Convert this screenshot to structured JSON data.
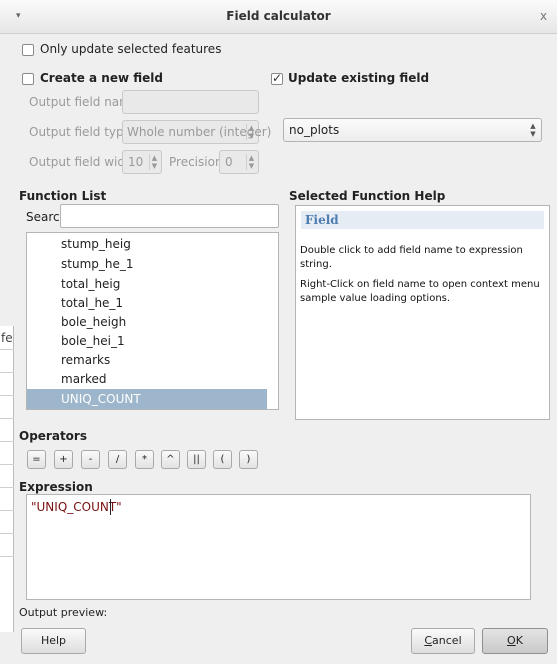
{
  "window": {
    "title": "Field calculator",
    "menu_glyph": "▾",
    "close_glyph": "x"
  },
  "options": {
    "only_selected": {
      "label": "Only update selected features",
      "checked": false
    },
    "create_new": {
      "label": "Create a new field",
      "checked": false
    },
    "update_existing": {
      "label": "Update existing field",
      "checked": true
    }
  },
  "new_field": {
    "name_label": "Output field name",
    "name_value": "",
    "type_label": "Output field type",
    "type_value": "Whole number (integer)",
    "width_label": "Output field width",
    "width_value": "10",
    "precision_label": "Precision",
    "precision_value": "0"
  },
  "existing_field": {
    "selected": "no_plots"
  },
  "function_list": {
    "heading": "Function List",
    "search_label": "Search",
    "search_value": "",
    "items": [
      "stump_heig",
      "stump_he_1",
      "total_heig",
      "total_he_1",
      "bole_heigh",
      "bole_hei_1",
      "remarks",
      "marked",
      "UNIQ_COUNT"
    ],
    "selected_index": 8
  },
  "help": {
    "heading": "Selected Function Help",
    "title": "Field",
    "line1": "Double click to add field name to expression string.",
    "line2a": "Right-Click on field name to open context menu",
    "line2b": "sample value loading options."
  },
  "operators": {
    "heading": "Operators",
    "items": [
      "=",
      "+",
      "-",
      "/",
      "*",
      "^",
      "||",
      "(",
      ")"
    ]
  },
  "expression": {
    "heading": "Expression",
    "value": "\"UNIQ_COUNT\""
  },
  "preview": {
    "label": "Output preview:"
  },
  "buttons": {
    "help": "Help",
    "cancel": "Cancel",
    "ok": "OK"
  },
  "background": {
    "clipped_label": "fe"
  },
  "colors": {
    "selection": "#9db6cc",
    "help_title": "#4c7cb0",
    "expression_text": "#7a1010"
  }
}
